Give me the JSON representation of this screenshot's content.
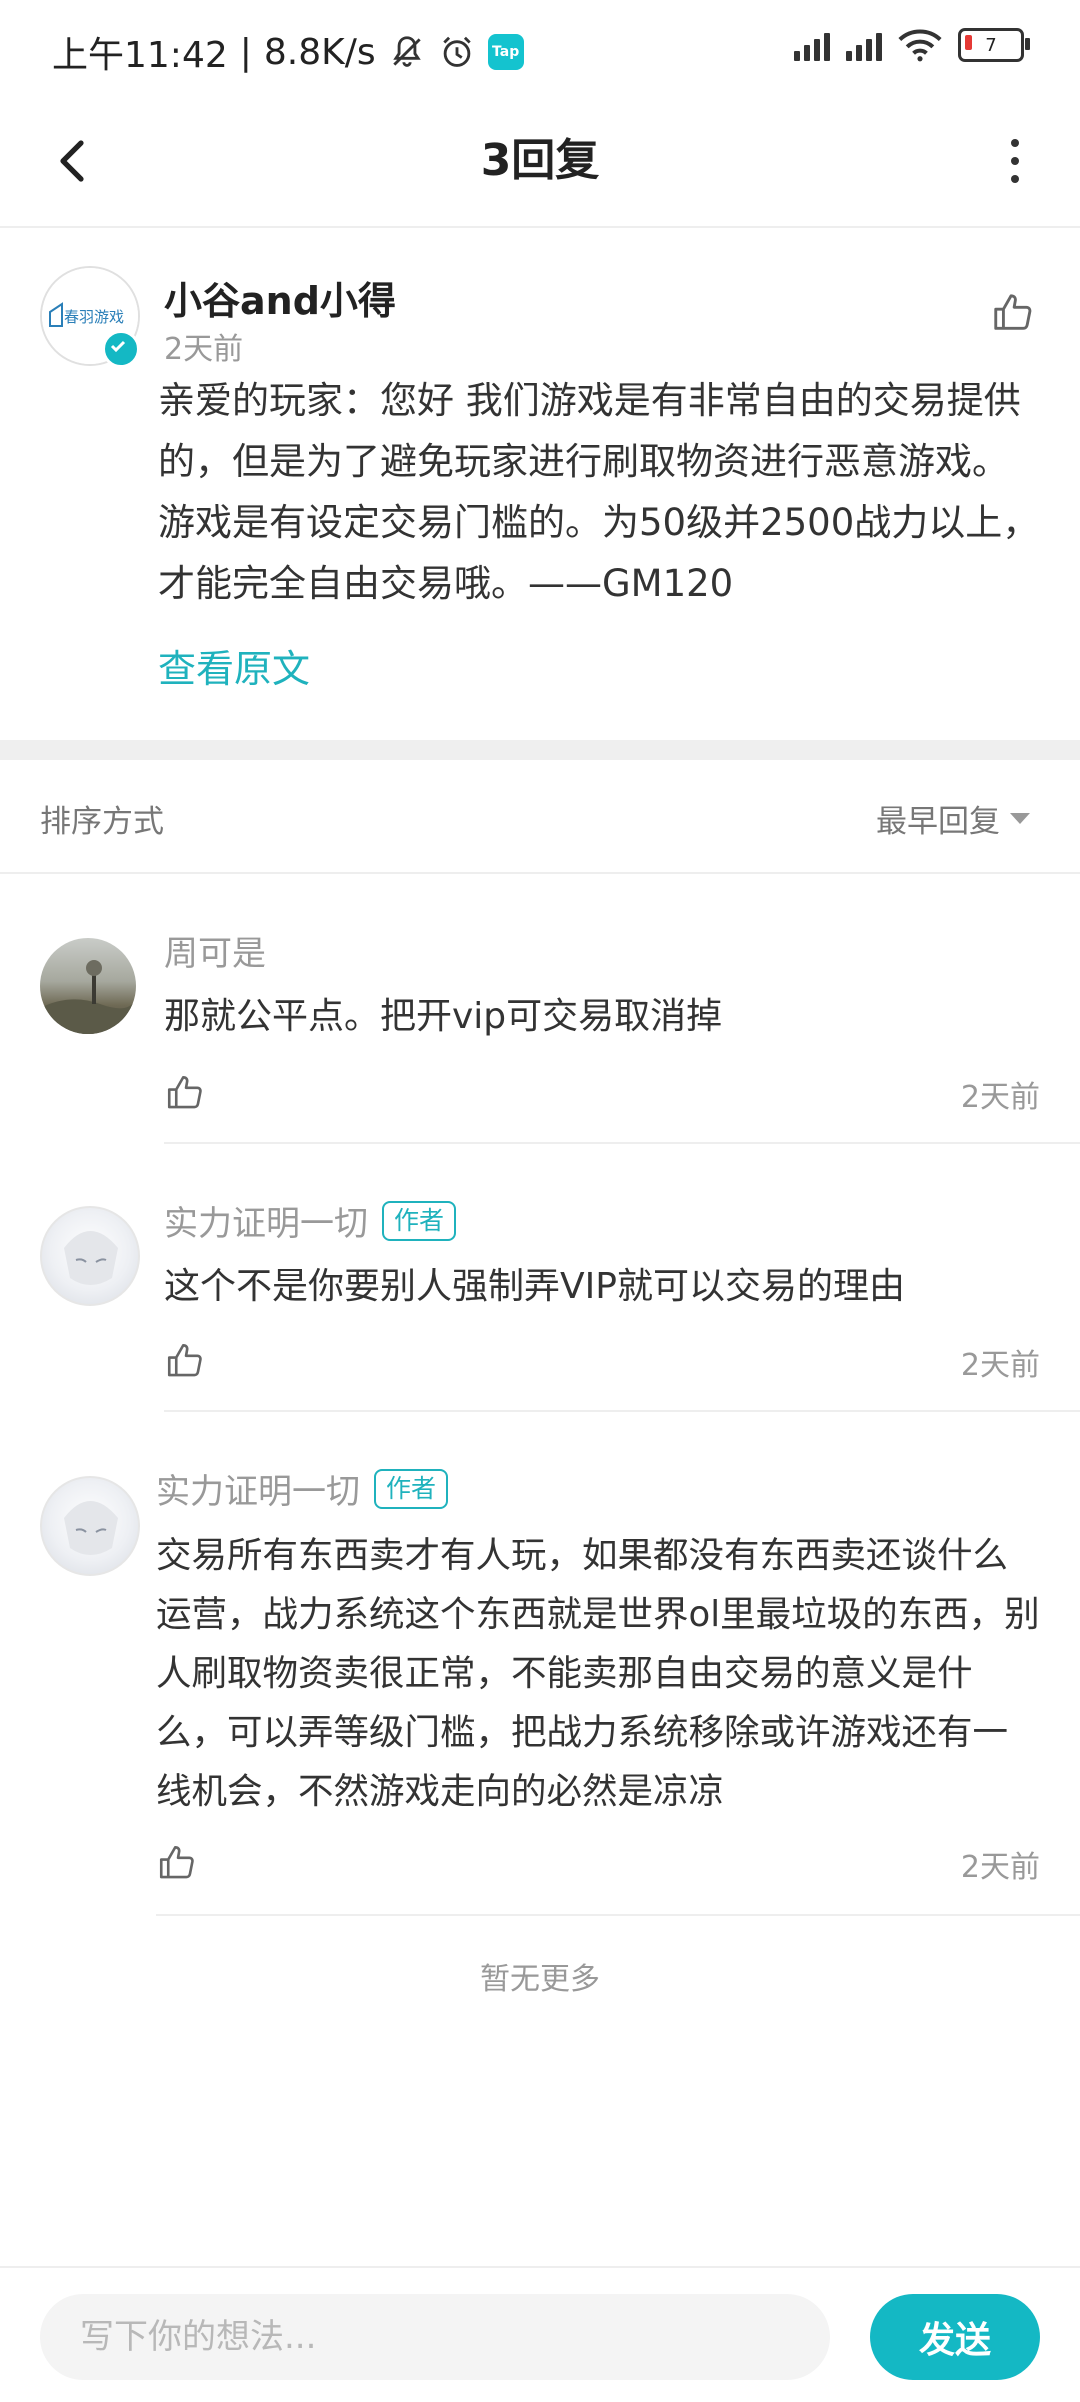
{
  "status_bar": {
    "time": "上午11:42",
    "separator": "|",
    "network_speed": "8.8K/s",
    "app_badge": "Tap",
    "battery_level": "7",
    "icons": [
      "bell-muted-icon",
      "alarm-icon",
      "tap-app-icon",
      "signal-icon",
      "hd-signal-icon",
      "wifi-icon",
      "battery-icon"
    ]
  },
  "header": {
    "title": "3回复"
  },
  "main_post": {
    "author": "小谷and小得",
    "time": "2天前",
    "text": "亲爱的玩家：您好 我们游戏是有非常自由的交易提供的，但是为了避免玩家进行刷取物资进行恶意游戏。游戏是有设定交易门槛的。为50级并2500战力以上，才能完全自由交易哦。——GM120",
    "view_original": "查看原文",
    "avatar_logo_text": "春羽游戏"
  },
  "sort": {
    "label": "排序方式",
    "value": "最早回复"
  },
  "replies": [
    {
      "author": "周可是",
      "is_author": false,
      "text": "那就公平点。把开vip可交易取消掉",
      "time": "2天前"
    },
    {
      "author": "实力证明一切",
      "is_author": true,
      "author_tag": "作者",
      "text": "这个不是你要别人强制弄VIP就可以交易的理由",
      "time": "2天前"
    },
    {
      "author": "实力证明一切",
      "is_author": true,
      "author_tag": "作者",
      "text": "交易所有东西卖才有人玩，如果都没有东西卖还谈什么运营，战力系统这个东西就是世界ol里最垃圾的东西，别人刷取物资卖很正常，不能卖那自由交易的意义是什么，可以弄等级门槛，把战力系统移除或许游戏还有一线机会，不然游戏走向的必然是凉凉",
      "time": "2天前"
    }
  ],
  "footer_note": "暂无更多",
  "composer": {
    "placeholder": "写下你的想法...",
    "send_label": "发送"
  },
  "colors": {
    "accent": "#14b8c4",
    "link": "#1fb2bd",
    "muted": "#999999"
  }
}
